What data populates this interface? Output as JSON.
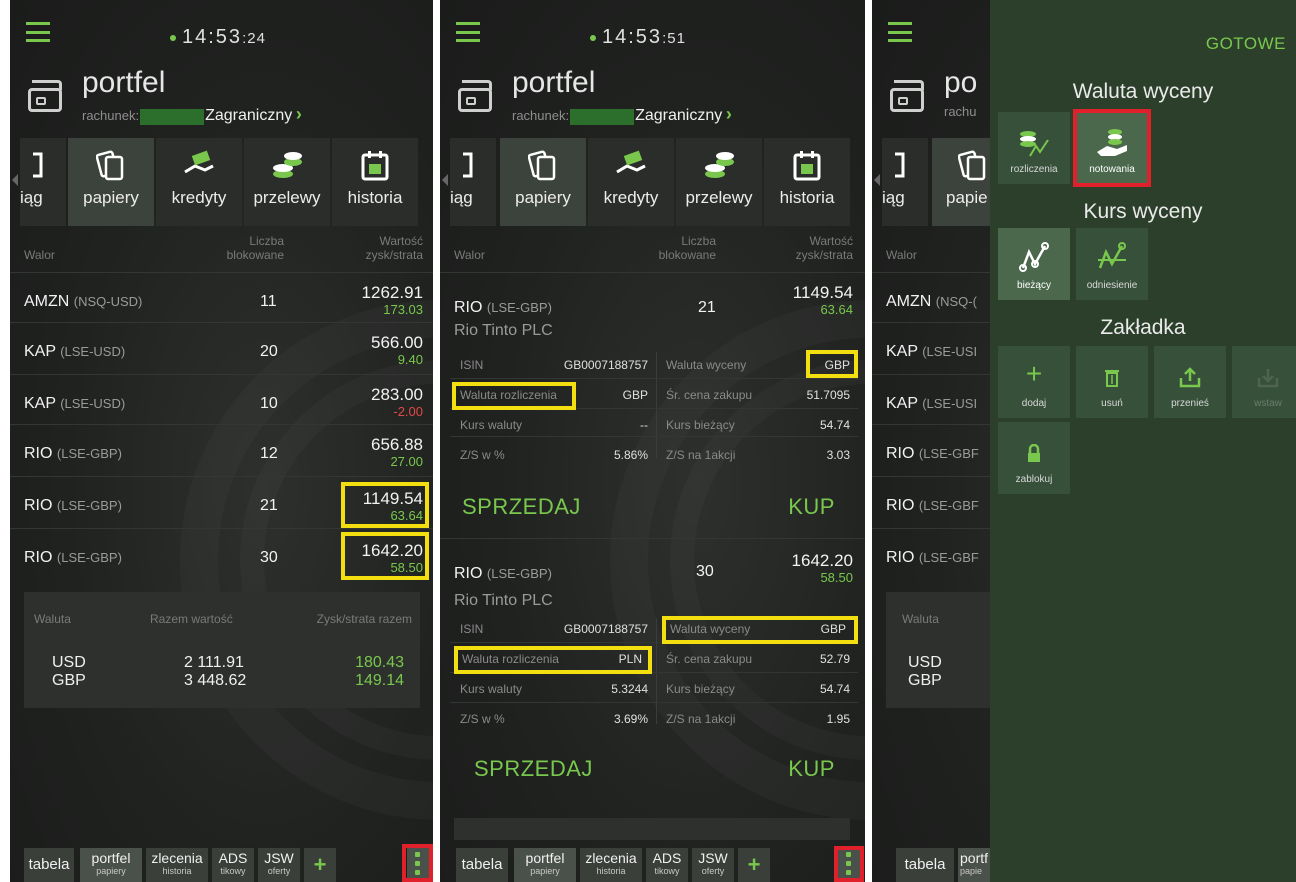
{
  "common": {
    "title": "portfel",
    "account_label": "rachunek:",
    "account_name": "Zagraniczny",
    "nav": [
      "iąg",
      "papiery",
      "kredyty",
      "przelewy",
      "historia"
    ],
    "nav_partial_p3": [
      "iąg",
      "papie"
    ]
  },
  "panel1": {
    "clock_main": "14:53",
    "clock_sec": ":24",
    "table_headers": {
      "walor": "Walor",
      "liczba": "Liczba",
      "blokowane": "blokowane",
      "wartosc": "Wartość",
      "zysk": "zysk/strata"
    },
    "rows": [
      {
        "sym": "AMZN",
        "exch": "(NSQ-USD)",
        "qty": "11",
        "value": "1262.91",
        "pl": "173.03",
        "neg": false
      },
      {
        "sym": "KAP",
        "exch": "(LSE-USD)",
        "qty": "20",
        "value": "566.00",
        "pl": "9.40",
        "neg": false
      },
      {
        "sym": "KAP",
        "exch": "(LSE-USD)",
        "qty": "10",
        "value": "283.00",
        "pl": "-2.00",
        "neg": true
      },
      {
        "sym": "RIO",
        "exch": "(LSE-GBP)",
        "qty": "12",
        "value": "656.88",
        "pl": "27.00",
        "neg": false
      },
      {
        "sym": "RIO",
        "exch": "(LSE-GBP)",
        "qty": "21",
        "value": "1149.54",
        "pl": "63.64",
        "neg": false
      },
      {
        "sym": "RIO",
        "exch": "(LSE-GBP)",
        "qty": "30",
        "value": "1642.20",
        "pl": "58.50",
        "neg": false
      }
    ],
    "summary": {
      "h_waluta": "Waluta",
      "h_razem": "Razem wartość",
      "h_zysk": "Zysk/strata razem",
      "rows": [
        {
          "cur": "USD",
          "total": "2 111.91",
          "pl": "180.43"
        },
        {
          "cur": "GBP",
          "total": "3 448.62",
          "pl": "149.14"
        }
      ]
    }
  },
  "panel2": {
    "clock_main": "14:53",
    "clock_sec": ":51",
    "positions": [
      {
        "sym": "RIO",
        "exch": "(LSE-GBP)",
        "qty": "21",
        "value": "1149.54",
        "pl": "63.64",
        "name": "Rio Tinto PLC",
        "isin_label": "ISIN",
        "isin": "GB0007188757",
        "waluta_wyceny_label": "Waluta wyceny",
        "waluta_wyceny": "GBP",
        "waluta_rozl_label": "Waluta rozliczenia",
        "waluta_rozl": "GBP",
        "sr_cena_label": "Śr. cena zakupu",
        "sr_cena": "51.7095",
        "kurs_waluty_label": "Kurs waluty",
        "kurs_waluty": "--",
        "kurs_biezacy_label": "Kurs bieżący",
        "kurs_biezacy": "54.74",
        "zs_proc_label": "Z/S w %",
        "zs_proc": "5.86%",
        "zs_akcji_label": "Z/S na 1akcji",
        "zs_akcji": "3.03",
        "sell": "SPRZEDAJ",
        "buy": "KUP"
      },
      {
        "sym": "RIO",
        "exch": "(LSE-GBP)",
        "qty": "30",
        "value": "1642.20",
        "pl": "58.50",
        "name": "Rio Tinto PLC",
        "isin_label": "ISIN",
        "isin": "GB0007188757",
        "waluta_wyceny_label": "Waluta wyceny",
        "waluta_wyceny": "GBP",
        "waluta_rozl_label": "Waluta rozliczenia",
        "waluta_rozl": "PLN",
        "sr_cena_label": "Śr. cena zakupu",
        "sr_cena": "52.79",
        "kurs_waluty_label": "Kurs waluty",
        "kurs_waluty": "5.3244",
        "kurs_biezacy_label": "Kurs bieżący",
        "kurs_biezacy": "54.74",
        "zs_proc_label": "Z/S w %",
        "zs_proc": "3.69%",
        "zs_akcji_label": "Z/S na 1akcji",
        "zs_akcji": "1.95",
        "sell": "SPRZEDAJ",
        "buy": "KUP"
      }
    ]
  },
  "panel3": {
    "rows_partial": [
      {
        "sym": "AMZN",
        "exch": "(NSQ-("
      },
      {
        "sym": "KAP",
        "exch": "(LSE-USI"
      },
      {
        "sym": "KAP",
        "exch": "(LSE-USI"
      },
      {
        "sym": "RIO",
        "exch": "(LSE-GBF"
      },
      {
        "sym": "RIO",
        "exch": "(LSE-GBF"
      },
      {
        "sym": "RIO",
        "exch": "(LSE-GBF"
      }
    ],
    "title_partial": "po",
    "acct_partial": "rachu",
    "summary_cur": [
      "USD",
      "GBP"
    ],
    "summary_h": "Waluta",
    "walor": "Walor",
    "overlay": {
      "done": "GOTOWE",
      "sec_waluta": "Waluta wyceny",
      "btn_rozliczenia": "rozliczenia",
      "btn_notowania": "notowania",
      "sec_kurs": "Kurs wyceny",
      "btn_biezacy": "bieżący",
      "btn_odniesienie": "odniesienie",
      "sec_zakladka": "Zakładka",
      "btn_dodaj": "dodaj",
      "btn_usun": "usuń",
      "btn_przenies": "przenieś",
      "btn_wstaw": "wstaw",
      "btn_zablokuj": "zablokuj"
    },
    "tab_partial": [
      "portf",
      "papie"
    ]
  },
  "bottom": {
    "tabela": "tabela",
    "portfel": "portfel",
    "portfel_sub": "papiery",
    "zlecenia": "zlecenia",
    "zlecenia_sub": "historia",
    "ads": "ADS",
    "ads_sub": "tikowy",
    "jsw": "JSW",
    "jsw_sub": "oferty",
    "plus": "+"
  },
  "colors": {
    "accent": "#79c84d",
    "negative": "#e34848",
    "highlight_yellow": "#f3df10",
    "highlight_red": "#e0202a",
    "overlay_bg": "#2b3f2b"
  }
}
